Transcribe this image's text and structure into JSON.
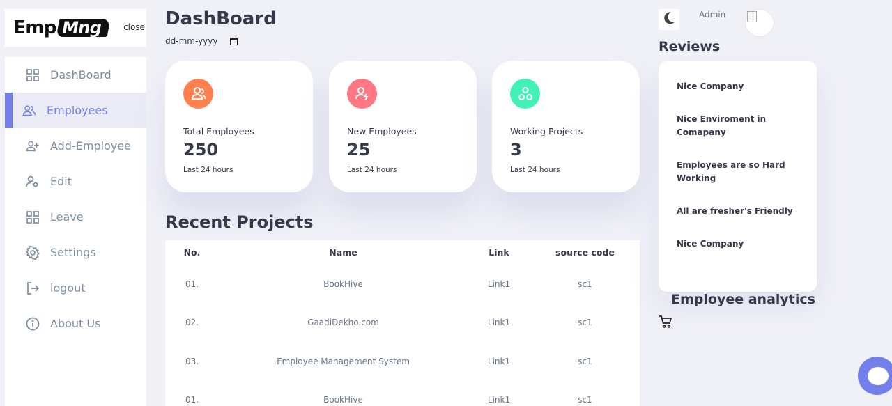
{
  "brand": {
    "logo_left": "Emp",
    "logo_right": "Mng",
    "close_label": "close"
  },
  "sidebar": {
    "items": [
      {
        "label": "DashBoard",
        "icon": "grid-icon",
        "active": false
      },
      {
        "label": "Employees",
        "icon": "users-icon",
        "active": true
      },
      {
        "label": "Add-Employee",
        "icon": "user-plus-icon",
        "active": false
      },
      {
        "label": "Edit",
        "icon": "user-gear-icon",
        "active": false
      },
      {
        "label": "Leave",
        "icon": "grid-icon",
        "active": false
      },
      {
        "label": "Settings",
        "icon": "gear-icon",
        "active": false
      },
      {
        "label": "logout",
        "icon": "logout-icon",
        "active": false
      },
      {
        "label": "About Us",
        "icon": "info-icon",
        "active": false
      }
    ]
  },
  "header": {
    "title": "DashBoard",
    "date_placeholder": "dd-mm-yyyy"
  },
  "cards": [
    {
      "label": "Total Employees",
      "value": "250",
      "sub": "Last 24 hours",
      "color": "#ff7f4e",
      "icon": "users-icon"
    },
    {
      "label": "New Employees",
      "value": "25",
      "sub": "Last 24 hours",
      "color": "#ff7782",
      "icon": "user-bolt-icon"
    },
    {
      "label": "Working Projects",
      "value": "3",
      "sub": "Last 24 hours",
      "color": "#41f1b6",
      "icon": "circles-icon"
    }
  ],
  "projects": {
    "title": "Recent Projects",
    "headers": [
      "No.",
      "Name",
      "Link",
      "source code"
    ],
    "rows": [
      [
        "01.",
        "BookHive",
        "Link1",
        "sc1"
      ],
      [
        "02.",
        "GaadiDekho.com",
        "Link1",
        "sc1"
      ],
      [
        "03.",
        "Employee Management System",
        "Link1",
        "sc1"
      ],
      [
        "01.",
        "BookHive",
        "Link1",
        "sc1"
      ]
    ]
  },
  "topbar": {
    "user": "Admin"
  },
  "reviews": {
    "title": "Reviews",
    "items": [
      "Nice Company",
      "Nice Enviroment in Comapany",
      "Employees are so Hard Working",
      "All are fresher's Friendly",
      "Nice Company"
    ]
  },
  "analytics": {
    "title": "Employee analytics"
  },
  "colors": {
    "primary": "#7380ec",
    "background": "#f0f0f7"
  }
}
